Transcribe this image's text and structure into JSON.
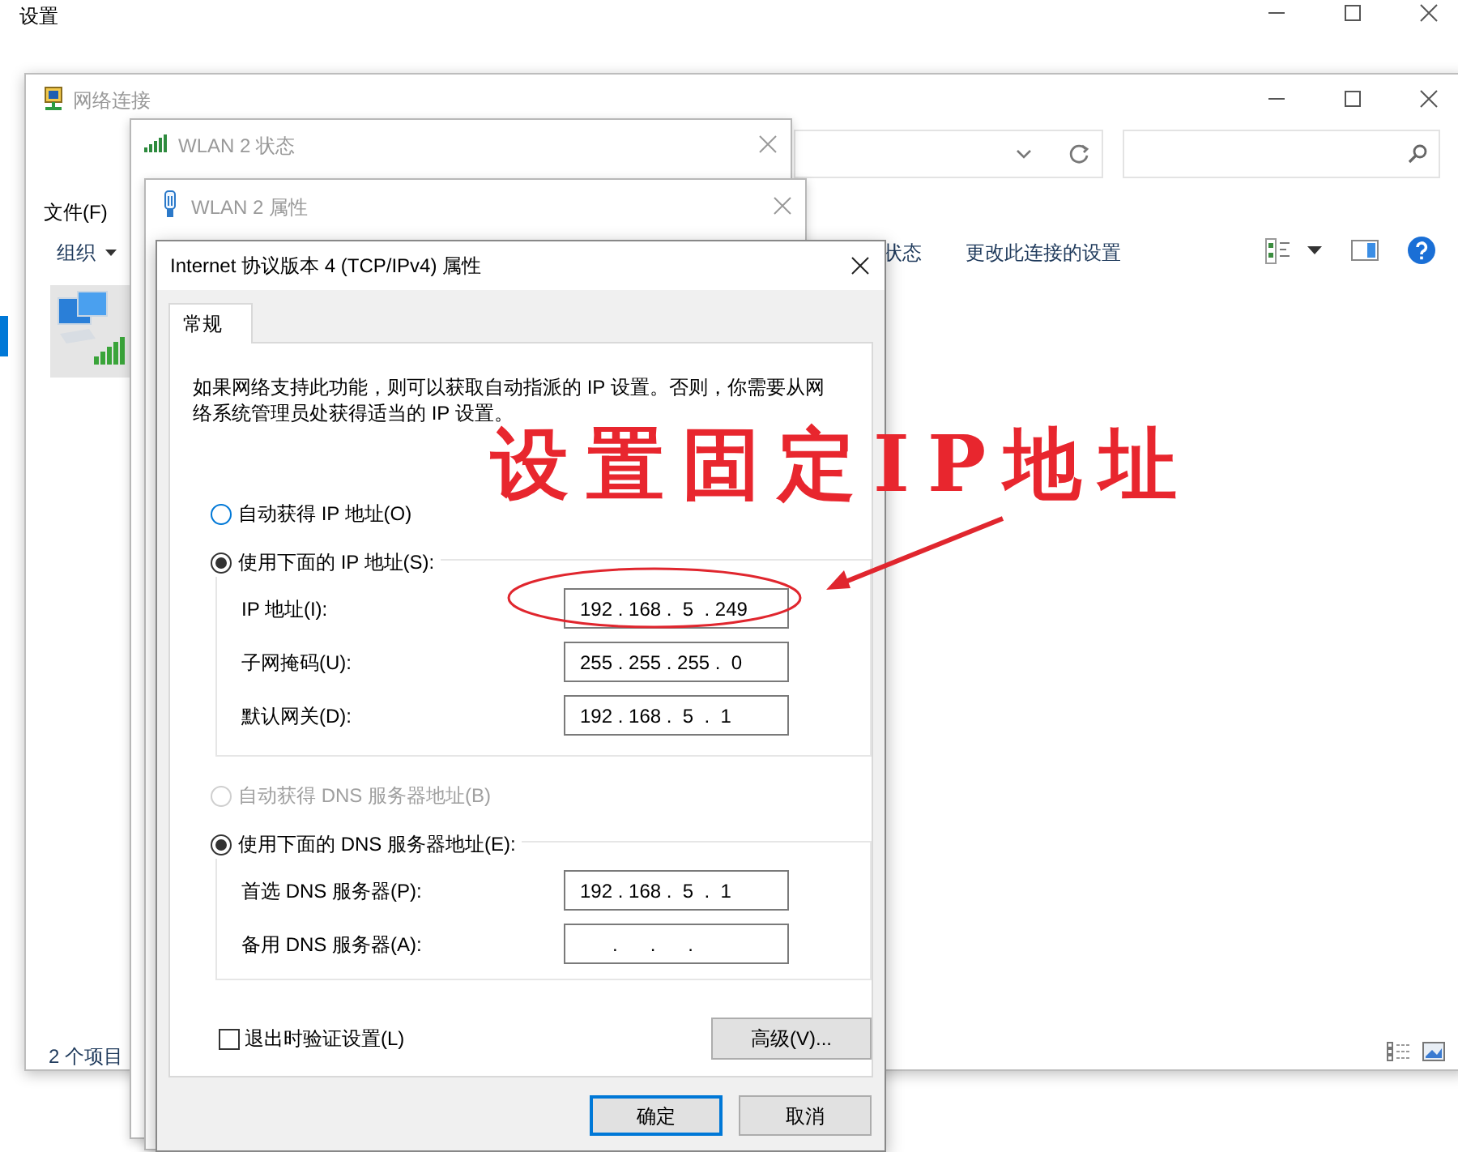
{
  "settings_window": {
    "title": "设置"
  },
  "network_window": {
    "title": "网络连接",
    "menu": [
      "文件(F)"
    ],
    "toolbar": [
      {
        "label": "组织",
        "kind": "dropdown"
      },
      {
        "label": "状态",
        "kind": "command"
      },
      {
        "label": "更改此连接的设置",
        "kind": "command"
      }
    ],
    "status_bar": "2 个项目"
  },
  "wlan_status_window": {
    "title": "WLAN 2 状态"
  },
  "wlan_properties_window": {
    "title": "WLAN 2 属性"
  },
  "ipv4_dialog": {
    "title": "Internet 协议版本 4 (TCP/IPv4) 属性",
    "tabs": [
      {
        "label": "常规",
        "selected": true
      }
    ],
    "description": "如果网络支持此功能，则可以获取自动指派的 IP 设置。否则，你需要从网络系统管理员处获得适当的 IP 设置。",
    "ip_options": [
      {
        "label": "自动获得 IP 地址(O)",
        "selected": false,
        "disabled": false
      },
      {
        "label": "使用下面的 IP 地址(S):",
        "selected": true,
        "disabled": false
      }
    ],
    "ip_fields": [
      {
        "label": "IP 地址(I):",
        "value": "192 . 168 .  5  . 249"
      },
      {
        "label": "子网掩码(U):",
        "value": "255 . 255 . 255 .  0"
      },
      {
        "label": "默认网关(D):",
        "value": "192 . 168 .  5  .  1"
      }
    ],
    "dns_options": [
      {
        "label": "自动获得 DNS 服务器地址(B)",
        "selected": false,
        "disabled": true
      },
      {
        "label": "使用下面的 DNS 服务器地址(E):",
        "selected": true,
        "disabled": false
      }
    ],
    "dns_fields": [
      {
        "label": "首选 DNS 服务器(P):",
        "value": "192 . 168 .  5  .  1"
      },
      {
        "label": "备用 DNS 服务器(A):",
        "value": "      .      .      ."
      }
    ],
    "validate_checkbox": {
      "label": "退出时验证设置(L)",
      "checked": false
    },
    "advanced_button": "高级(V)...",
    "buttons": [
      {
        "label": "确定",
        "default": true
      },
      {
        "label": "取消",
        "default": false
      }
    ]
  },
  "annotation": {
    "text": "设置固定IP地址"
  }
}
